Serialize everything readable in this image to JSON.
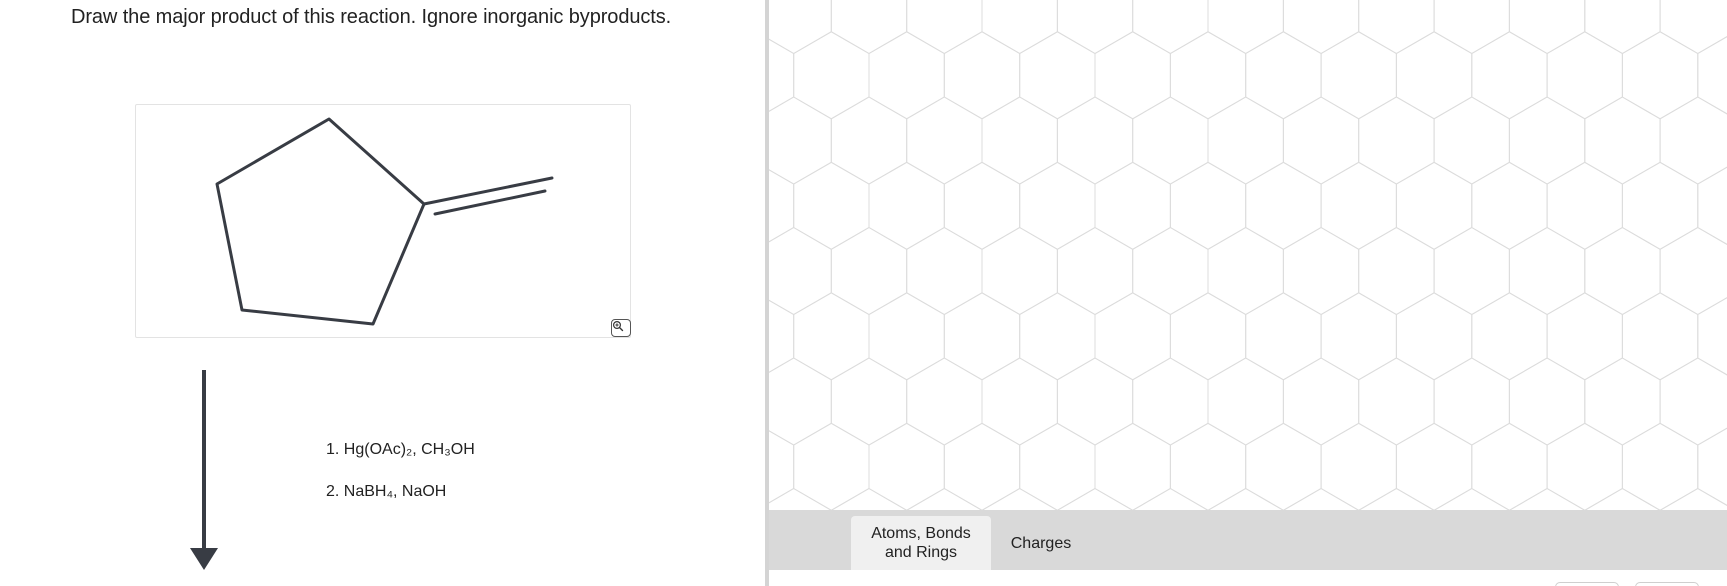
{
  "question": {
    "prompt": "Draw the major product of this reaction. Ignore inorganic byproducts."
  },
  "reactant": {
    "zoom_icon": "magnifier-plus-icon"
  },
  "conditions": [
    "1. Hg(OAc)₂, CH₃OH",
    "2. NaBH₄, NaOH"
  ],
  "toolbar": {
    "tabs": [
      {
        "label_line1": "Atoms, Bonds",
        "label_line2": "and Rings",
        "active": true
      },
      {
        "label": "Charges",
        "active": false
      }
    ]
  },
  "colors": {
    "bond": "#383c44",
    "grid": "#dcdcdc",
    "divider": "#d4d4d4",
    "toolbar": "#d9d9d9",
    "active_tab": "#f0f0f0"
  }
}
